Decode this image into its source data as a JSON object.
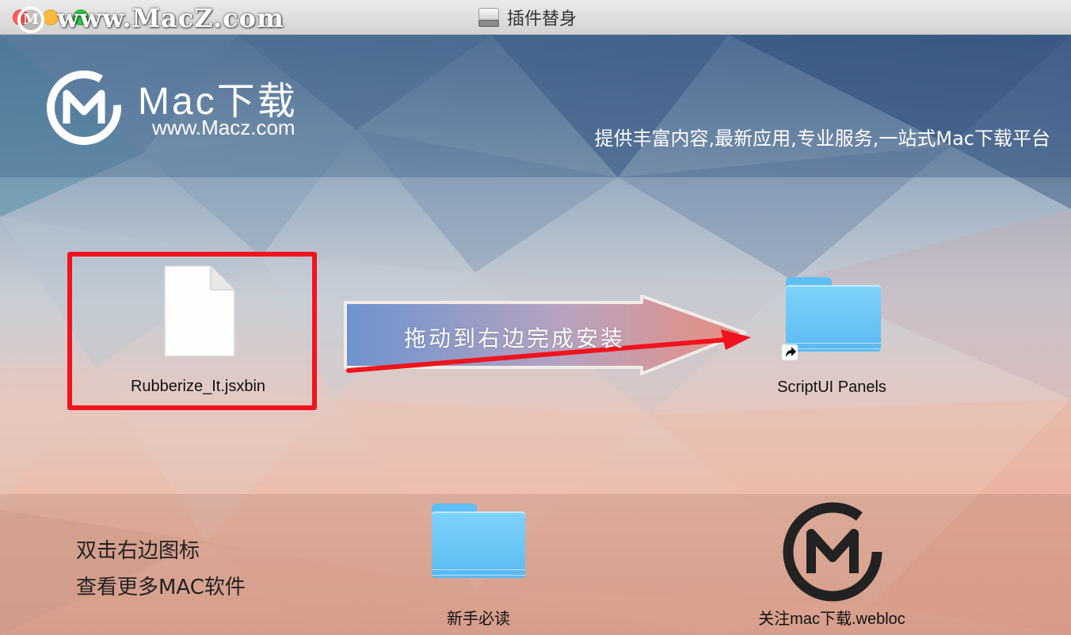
{
  "window": {
    "title": "插件替身",
    "watermark": "www.MacZ.com"
  },
  "header": {
    "brand_name": "Mac下载",
    "brand_url": "www.Macz.com",
    "tagline": "提供丰富内容,最新应用,专业服务,一站式Mac下载平台"
  },
  "install": {
    "file_label": "Rubberize_It.jsxbin",
    "arrow_text": "拖动到右边完成安装",
    "target_label": "ScriptUI Panels"
  },
  "footer": {
    "hint_line1": "双击右边图标",
    "hint_line2": "查看更多MAC软件",
    "readme_label": "新手必读",
    "webloc_label": "关注mac下载.webloc"
  },
  "colors": {
    "selection": "#f0141e",
    "folder": "#6cc6f7"
  }
}
